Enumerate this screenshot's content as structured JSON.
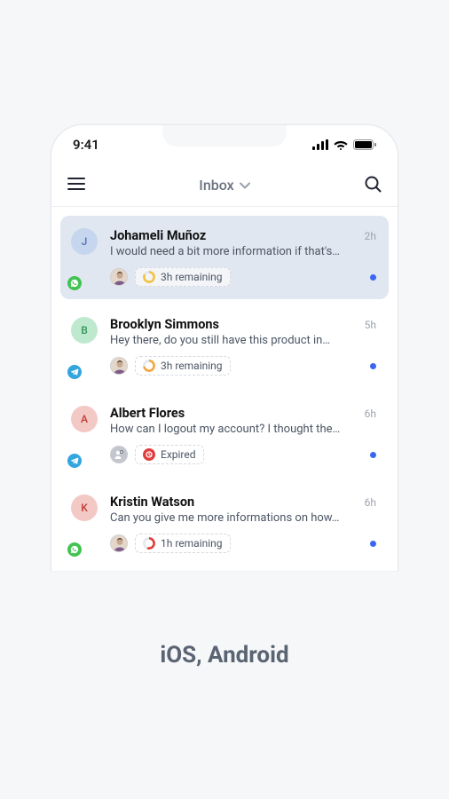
{
  "status_bar": {
    "time": "9:41"
  },
  "nav": {
    "title": "Inbox"
  },
  "caption": "iOS, Android",
  "colors": {
    "blue": "#3a66f2",
    "telegram": "#33a6de",
    "whatsapp": "#42c352",
    "expired_red": "#e23d3d"
  },
  "conversations": [
    {
      "initial": "J",
      "avatar_bg": "#c6d6ee",
      "avatar_fg": "#5a78b8",
      "channel": "whatsapp",
      "name": "Johameli Muñoz",
      "preview": "I would need a bit more information if that's…",
      "time": "2h",
      "assignee": "person",
      "sla_label": "3h remaining",
      "sla_state": "ok",
      "unread": true,
      "selected": true
    },
    {
      "initial": "B",
      "avatar_bg": "#bfe9cf",
      "avatar_fg": "#3d9a5e",
      "channel": "telegram",
      "name": "Brooklyn Simmons",
      "preview": "Hey there, do you still have this product in…",
      "time": "5h",
      "assignee": "person",
      "sla_label": "3h remaining",
      "sla_state": "warn",
      "unread": true,
      "selected": false
    },
    {
      "initial": "A",
      "avatar_bg": "#f3c9c6",
      "avatar_fg": "#c2463e",
      "channel": "telegram",
      "name": "Albert Flores",
      "preview": "How can I logout my account? I thought the…",
      "time": "6h",
      "assignee": "unassigned",
      "sla_label": "Expired",
      "sla_state": "expired",
      "unread": true,
      "selected": false
    },
    {
      "initial": "K",
      "avatar_bg": "#f3c9c6",
      "avatar_fg": "#c2463e",
      "channel": "whatsapp",
      "name": "Kristin Watson",
      "preview": "Can you give me more informations on how…",
      "time": "6h",
      "assignee": "person",
      "sla_label": "1h remaining",
      "sla_state": "critical",
      "unread": true,
      "selected": false
    }
  ]
}
